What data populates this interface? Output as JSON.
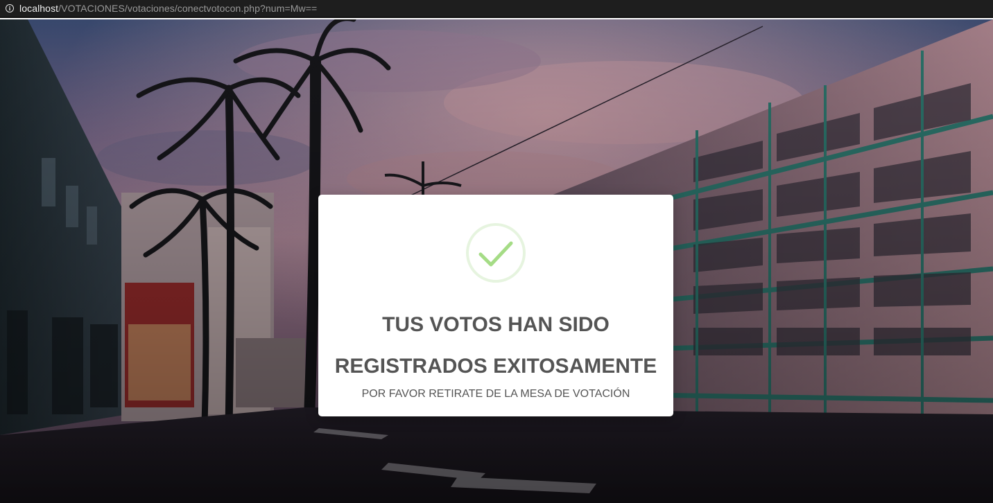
{
  "browser": {
    "info_icon": "info-icon",
    "url_host": "localhost",
    "url_path": "/VOTACIONES/votaciones/conectvotocon.php?num=Mw=="
  },
  "modal": {
    "icon": "success-check-icon",
    "title_line1": "TUS VOTOS HAN SIDO",
    "title_line2": "REGISTRADOS EXITOSAMENTE",
    "subtitle": "POR FAVOR RETIRATE DE LA MESA DE VOTACIÓN"
  },
  "colors": {
    "check_green": "#a5dc86",
    "ring_green": "#e6f4df",
    "title_text": "#545454",
    "modal_bg": "#ffffff"
  }
}
